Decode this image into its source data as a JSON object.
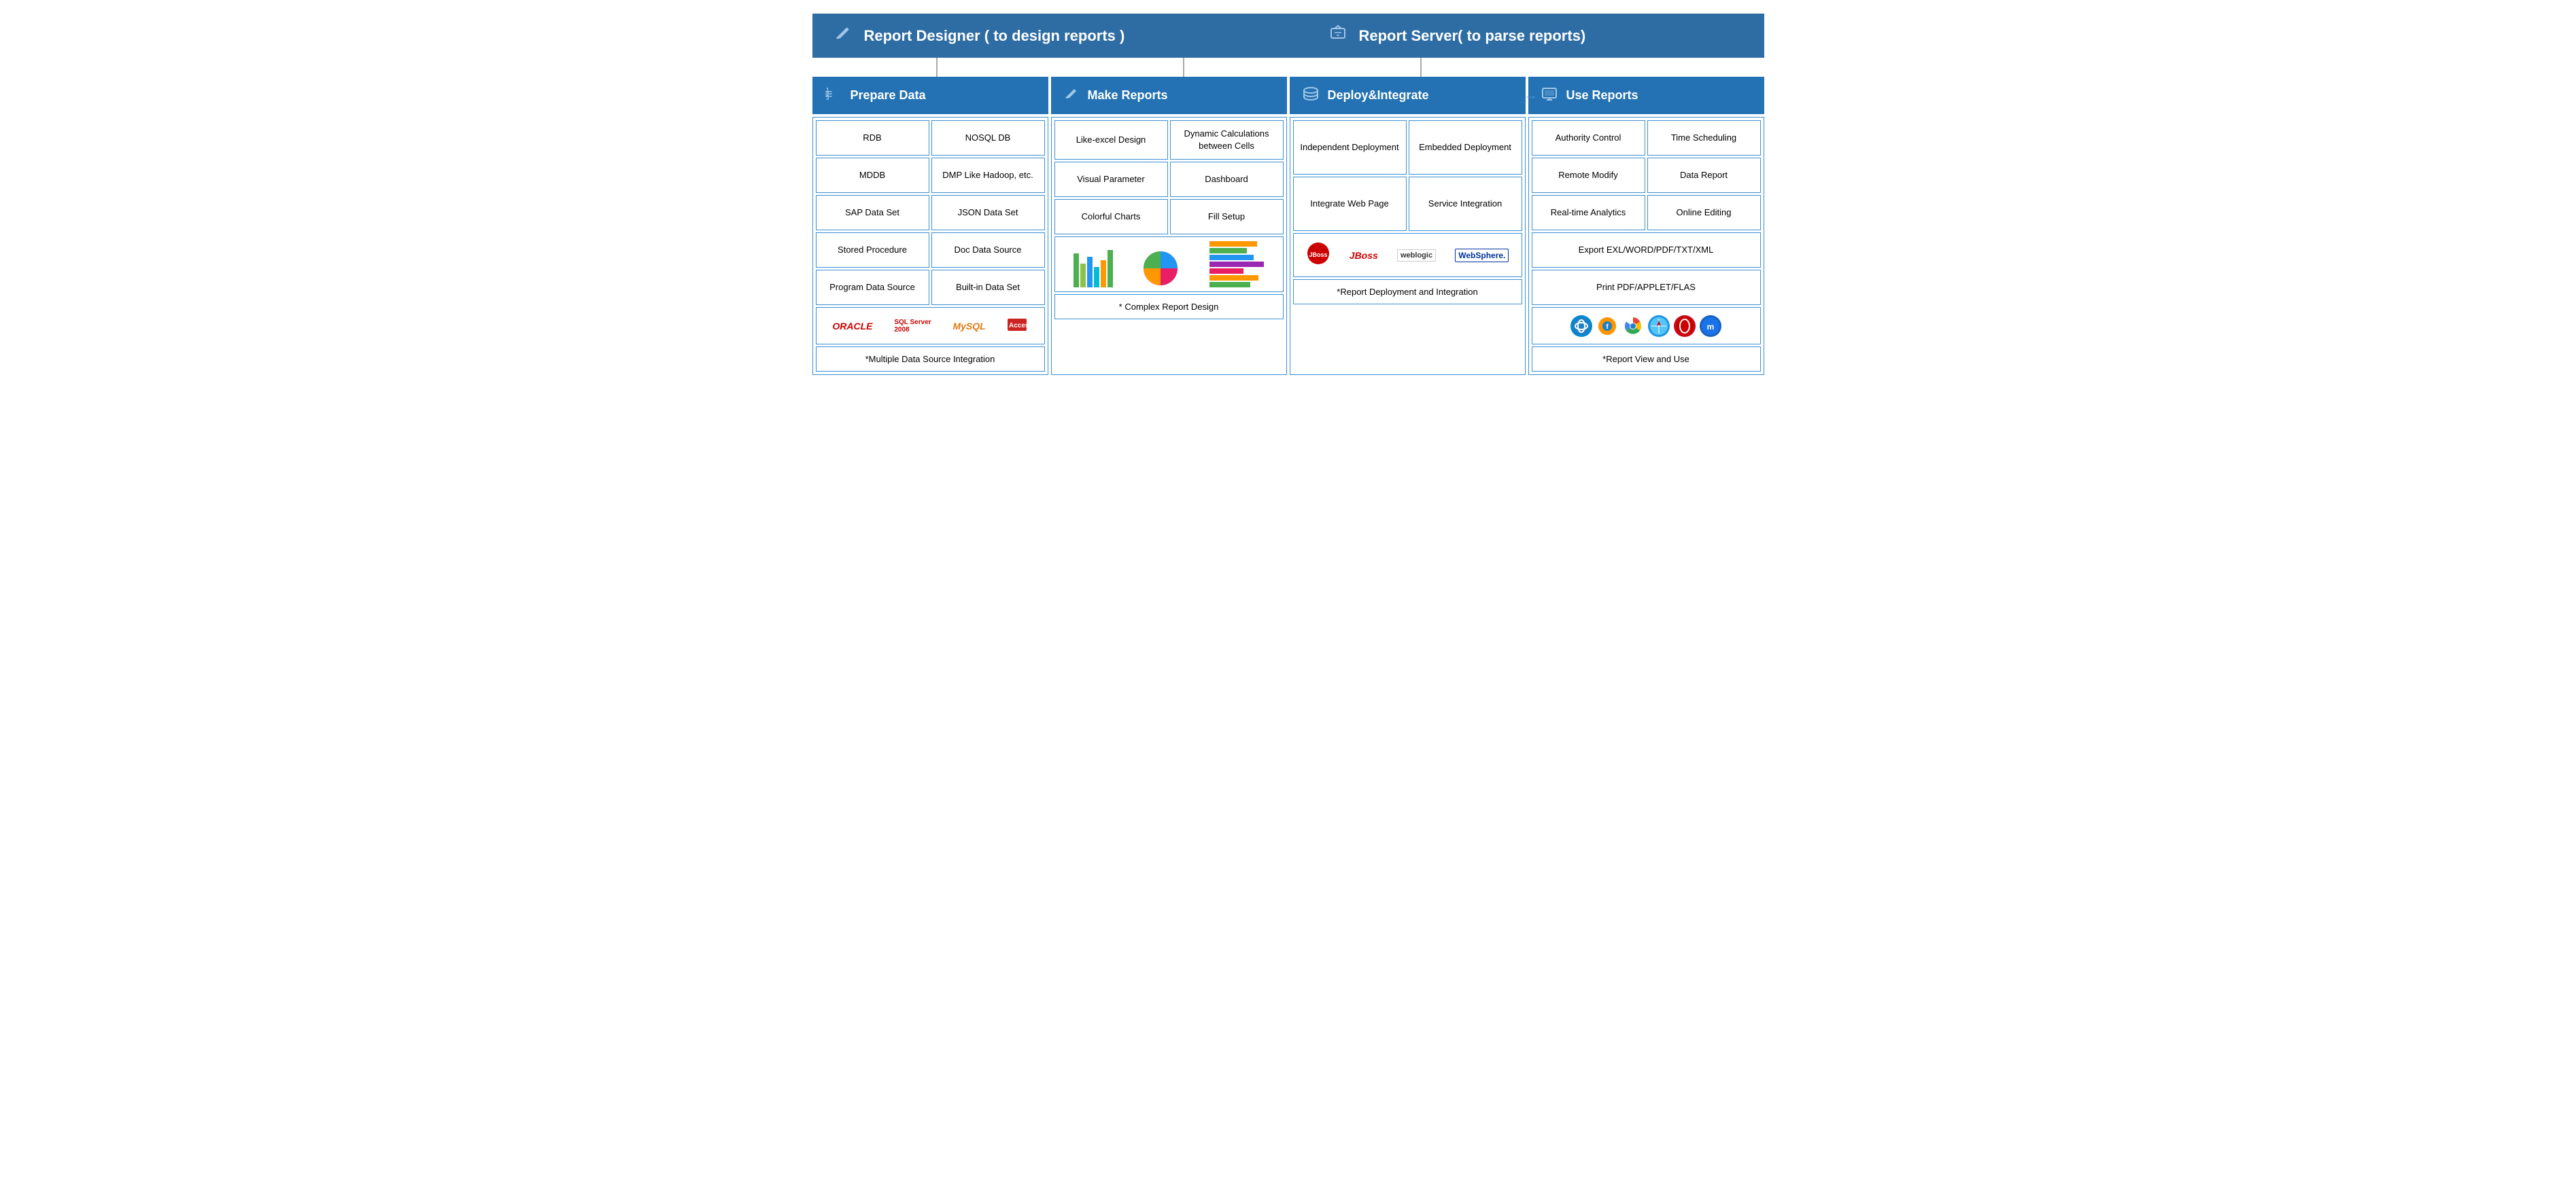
{
  "headers": {
    "designer": {
      "icon": "✏️",
      "label": "Report Designer ( to design reports )"
    },
    "server": {
      "icon": "📨",
      "label": "Report Server( to parse reports)"
    }
  },
  "sections": [
    {
      "id": "prepare",
      "icon": "☰",
      "label": "Prepare Data",
      "cells": [
        [
          "RDB",
          "NOSQL DB"
        ],
        [
          "MDDB",
          "DMP Like Hadoop, etc."
        ],
        [
          "SAP Data Set",
          "JSON Data Set"
        ],
        [
          "Stored Procedure",
          "Doc Data Source"
        ],
        [
          "Program Data Source",
          "Built-in Data Set"
        ]
      ],
      "logo_section": true,
      "bottom_caption": "*Multiple Data Source Integration"
    },
    {
      "id": "make",
      "icon": "✏️",
      "label": "Make Reports",
      "cells": [
        [
          "Like-excel Design",
          "Dynamic Calculations between Cells"
        ],
        [
          "Visual Parameter",
          "Dashboard"
        ],
        [
          "Colorful Charts",
          "Fill Setup"
        ]
      ],
      "chart_section": true,
      "bottom_caption": "* Complex Report Design"
    },
    {
      "id": "deploy",
      "icon": "🗄️",
      "label": "Deploy&Integrate",
      "cells": [
        [
          "Independent Deployment",
          "Embedded Deployment"
        ],
        [
          "Integrate Web Page",
          "Service Integration"
        ]
      ],
      "server_logos": true,
      "bottom_caption": "*Report Deployment and Integration"
    },
    {
      "id": "use",
      "icon": "🖥️",
      "label": "Use Reports",
      "cells_single": [
        [
          "Authority Control",
          "Time Scheduling"
        ],
        [
          "Remote Modify",
          "Data Report"
        ],
        [
          "Real-time Analytics",
          "Online Editing"
        ],
        [
          "Export EXL/WORD/PDF/TXT/XML"
        ],
        [
          "Print PDF/APPLET/FLAS"
        ]
      ],
      "browser_section": true,
      "bottom_caption": "*Report View and Use"
    }
  ],
  "browsers": [
    "IE",
    "Firefox",
    "Chrome",
    "Safari",
    "Opera",
    "Maxthon"
  ],
  "chart_colors": {
    "bars": [
      "#4caf50",
      "#8bc34a",
      "#2196f3",
      "#00bcd4",
      "#ff9800"
    ],
    "pie": [
      "#2196f3",
      "#9c27b0",
      "#e91e63",
      "#ff9800",
      "#4caf50"
    ],
    "hbars": [
      "#ff9800",
      "#4caf50",
      "#2196f3",
      "#9c27b0"
    ]
  }
}
